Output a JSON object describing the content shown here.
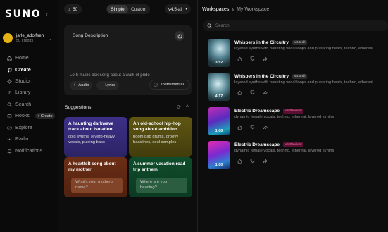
{
  "app": {
    "logo": "SUNO"
  },
  "user": {
    "name": "jarle_adolfsen",
    "credits": "50 credits"
  },
  "sidebar": {
    "items": [
      {
        "label": "Home",
        "icon": "home-icon"
      },
      {
        "label": "Create",
        "icon": "music-note-icon",
        "active": true
      },
      {
        "label": "Studio",
        "icon": "sparkle-icon"
      },
      {
        "label": "Library",
        "icon": "library-icon"
      },
      {
        "label": "Search",
        "icon": "search-icon"
      },
      {
        "label": "Hooks",
        "icon": "hooks-icon"
      },
      {
        "label": "Explore",
        "icon": "compass-icon"
      },
      {
        "label": "Radio",
        "icon": "radio-icon"
      },
      {
        "label": "Notifications",
        "icon": "bell-icon"
      }
    ],
    "hooks_create_label": "+ Create"
  },
  "toolbar": {
    "credits": "50",
    "mode_simple": "Simple",
    "mode_custom": "Custom",
    "version": "v4.5-all"
  },
  "song_description": {
    "label": "Song Description",
    "value": "Lo-fi music box song about a walk of pride",
    "audio_label": "Audio",
    "lyrics_label": "Lyrics",
    "instrumental_label": "Instrumental"
  },
  "suggestions": {
    "title": "Suggestions",
    "tiles": [
      {
        "title": "A haunting darkwave track about isolation",
        "subtitle": "cold synths, reverb-heavy vocals, pulsing bass",
        "color": "#3b2f84"
      },
      {
        "title": "An old-school hip-hop song about ambition",
        "subtitle": "boom bap drums, groovy basslines, soul samples",
        "color": "#5d5410"
      },
      {
        "title": "A heartfelt song about my mother",
        "input_placeholder": "What's your mother's name?",
        "color": "#6b2c14"
      },
      {
        "title": "A summer vacation road trip anthem",
        "input_placeholder": "Where are you heading?",
        "color": "#0f4a2a"
      }
    ]
  },
  "workspace": {
    "breadcrumb_root": "Workspaces",
    "breadcrumb_current": "My Workspace",
    "search_placeholder": "Search",
    "songs": [
      {
        "title": "Whispers in the Circuitry",
        "badge": "v4.5-all",
        "badge_style": "grey",
        "description": "layered synths with haunting vocal loops and pulsating beats, techno, ethereal",
        "duration": "3:52"
      },
      {
        "title": "Whispers in the Circuitry",
        "badge": "v4.5-all",
        "badge_style": "grey",
        "description": "layered synths with haunting vocal loops and pulsating beats, techno, ethereal",
        "duration": "4:17"
      },
      {
        "title": "Electric Dreamscape",
        "badge": "v5 Preview",
        "badge_style": "pink",
        "description": "dynamic female vocals, techno, ethereal, layered synths",
        "duration": "1:00"
      },
      {
        "title": "Electric Dreamscape",
        "badge": "v5 Preview",
        "badge_style": "pink",
        "description": "dynamic female vocals, techno, ethereal, layered synths",
        "duration": "1:00"
      }
    ]
  },
  "colors": {
    "accent_pink": "#ff6fa3",
    "avatar": "#e3b316",
    "background": "#0d0d0d"
  }
}
